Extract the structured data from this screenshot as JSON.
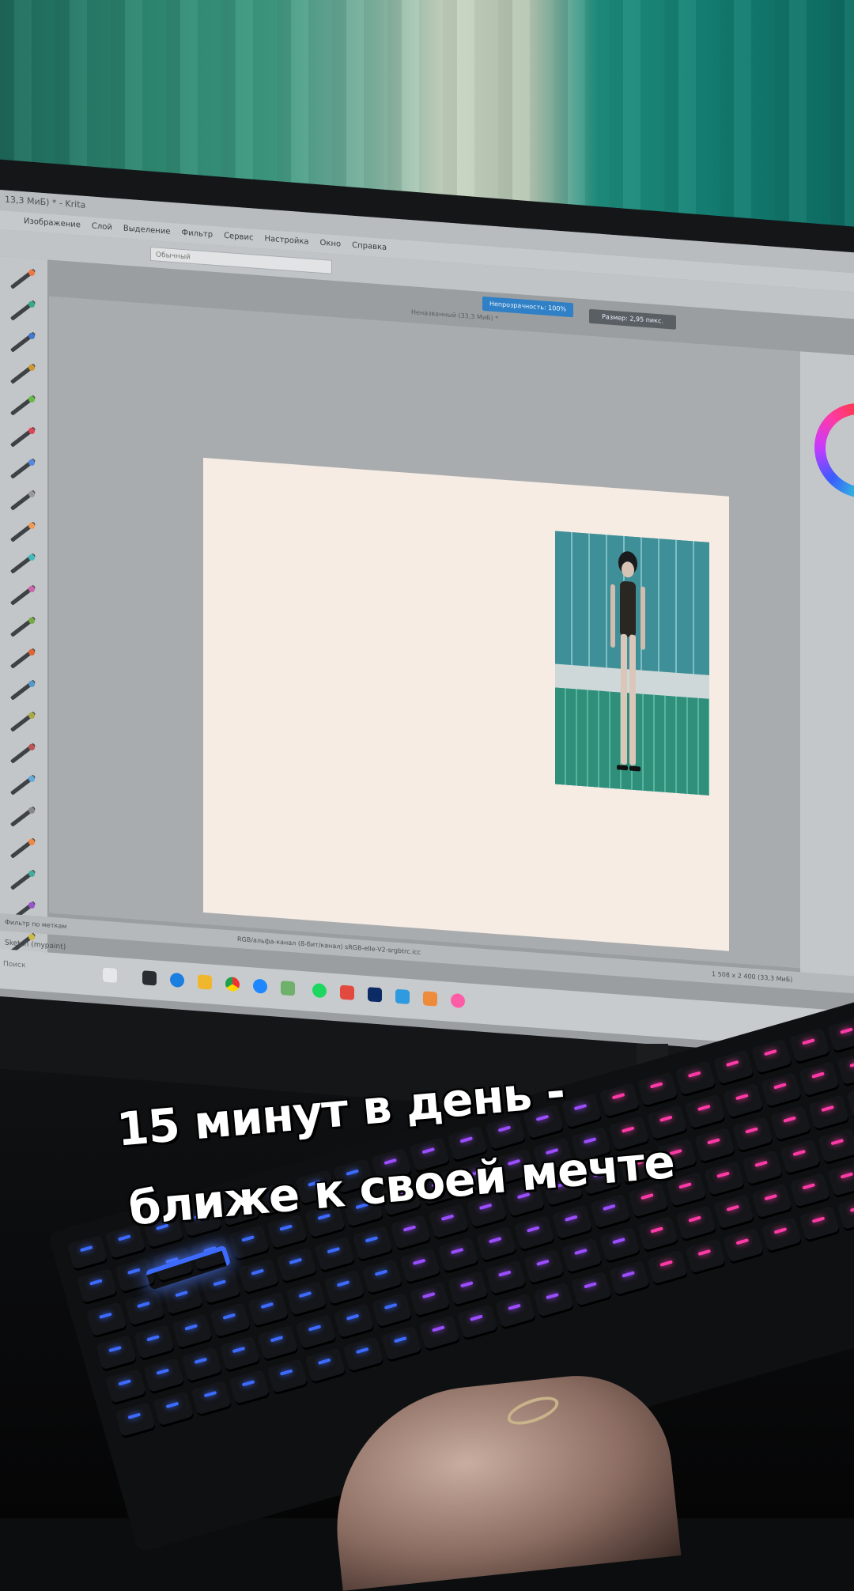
{
  "caption": {
    "line1": "15 минут в день -",
    "line2": "ближе к своей мечте"
  },
  "krita": {
    "window_title": "13,3 МиБ) * - Krita",
    "menu": [
      "Изображение",
      "Слой",
      "Выделение",
      "Фильтр",
      "Сервис",
      "Настройка",
      "Окно",
      "Справка"
    ],
    "toolbar": {
      "brush_preset": "Обычный",
      "opacity_label": "Непрозрачность: 100%",
      "size_label": "Размер: 2,95 пикс."
    },
    "document_tab": "Неназванный (33,3 МиБ) *",
    "statusbar": {
      "colorspace": "RGB/альфа-канал (8-бит/канал) sRGB-elle-V2-srgbtrc.icc",
      "size": "1 508 x 2 400 (33,3 МиБ)",
      "brush": "Sketch (mypaint)",
      "filter_label": "Фильтр по меткам"
    },
    "taskbar": {
      "search_placeholder": "Поиск"
    }
  },
  "colors": {
    "opacity_slider": "#2f80c6",
    "canvas": "#f6ece3",
    "keyboard_glow_blue": "#3d6bff",
    "keyboard_glow_pink": "#ff3aa7"
  }
}
